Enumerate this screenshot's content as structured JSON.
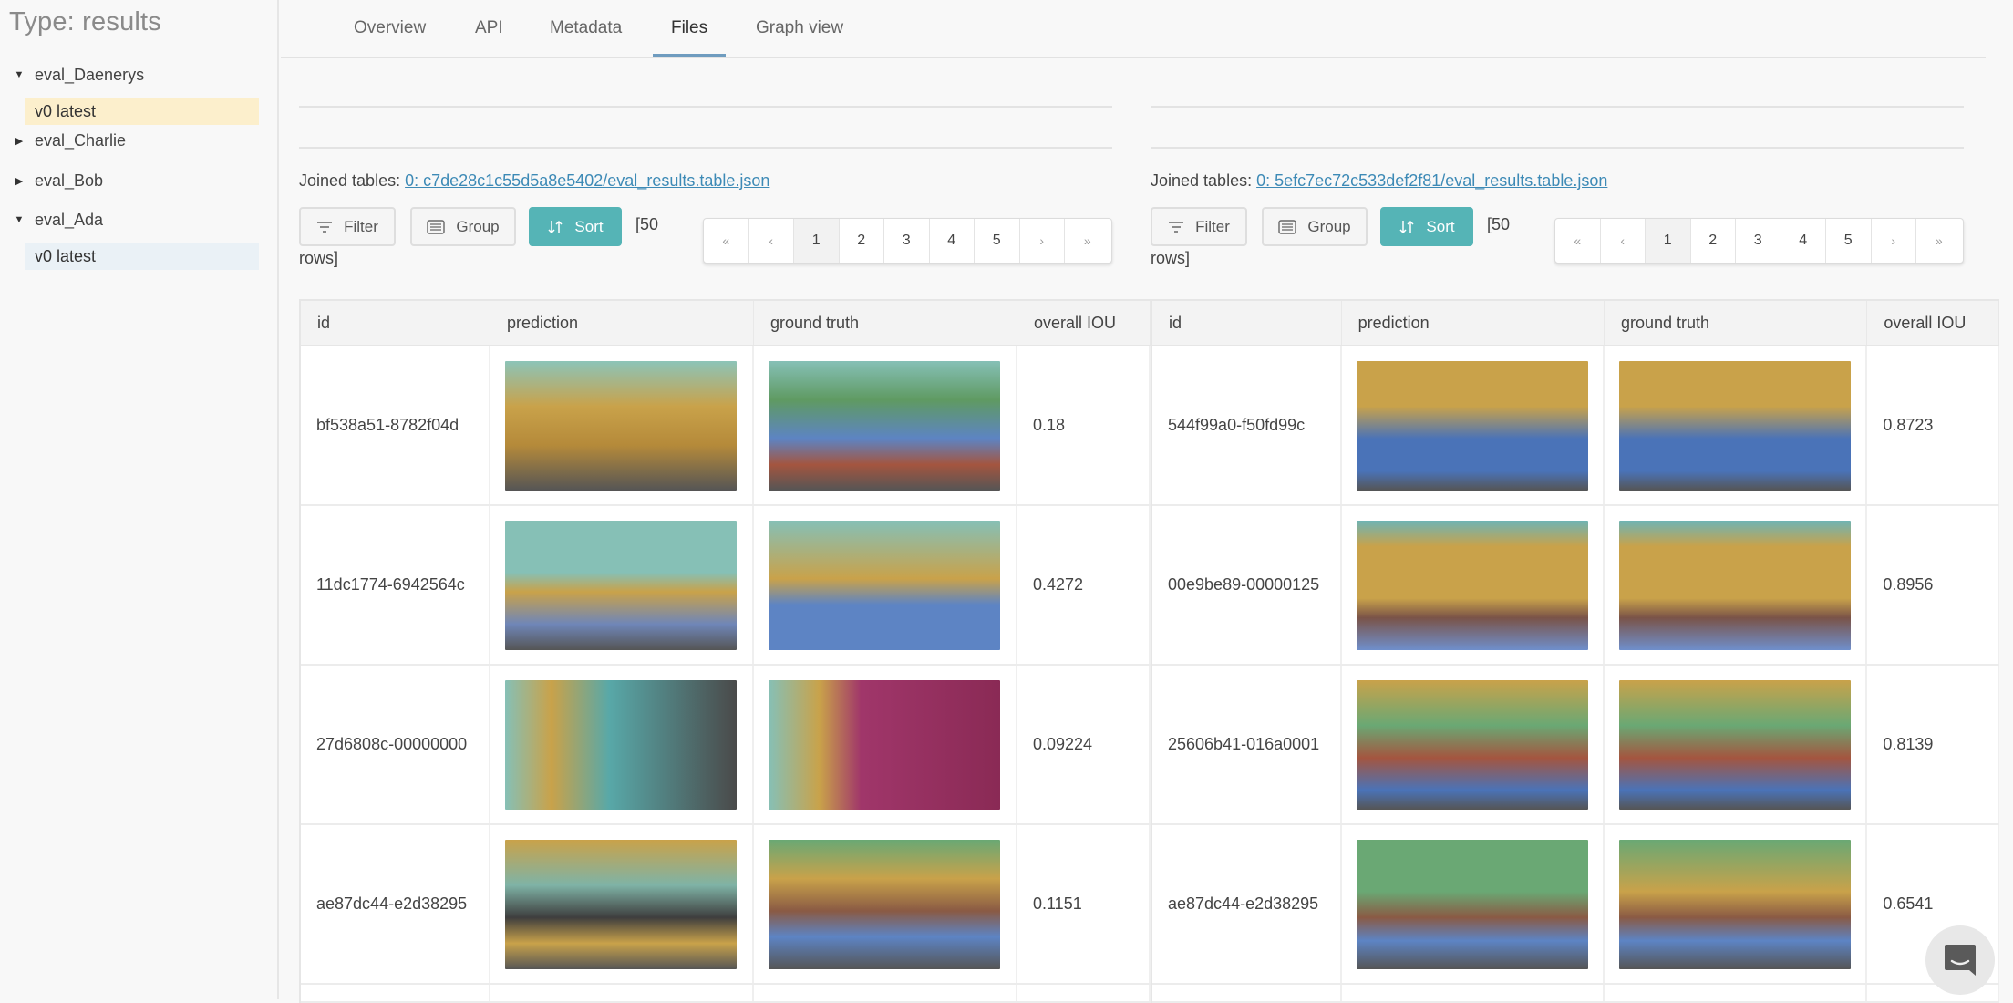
{
  "sidebar": {
    "title": "Type: results",
    "items": [
      {
        "label": "eval_Daenerys",
        "expanded": true,
        "versions": [
          {
            "label": "v0 latest",
            "highlight": "yellow"
          }
        ]
      },
      {
        "label": "eval_Charlie",
        "expanded": false,
        "versions": []
      },
      {
        "label": "eval_Bob",
        "expanded": false,
        "versions": []
      },
      {
        "label": "eval_Ada",
        "expanded": true,
        "versions": [
          {
            "label": "v0 latest",
            "highlight": "blue"
          }
        ]
      }
    ]
  },
  "tabs": [
    {
      "label": "Overview",
      "active": false
    },
    {
      "label": "API",
      "active": false
    },
    {
      "label": "Metadata",
      "active": false
    },
    {
      "label": "Files",
      "active": true
    },
    {
      "label": "Graph view",
      "active": false
    }
  ],
  "colors": {
    "accent_teal": "#55b4b6",
    "link_blue": "#3d8ab6",
    "tab_underline": "#6f9cbf",
    "highlight_yellow": "#fcefcc",
    "highlight_blue": "#eaf1f6"
  },
  "panels": [
    {
      "joined_label": "Joined tables:",
      "joined_link": "0: c7de28c1c55d5a8e5402/eval_results.table.json",
      "buttons": {
        "filter": "Filter",
        "group": "Group",
        "sort": "Sort"
      },
      "rows_note_1": "[50",
      "rows_note_2": "rows]",
      "pagination": [
        "«",
        "‹",
        "1",
        "2",
        "3",
        "4",
        "5",
        "›",
        "»"
      ],
      "current_page": "1",
      "columns": [
        "id",
        "prediction",
        "ground truth",
        "overall IOU"
      ],
      "rows": [
        {
          "id": "bf538a51-8782f04d",
          "prediction": "segmentation-image",
          "ground_truth": "segmentation-image",
          "iou": "0.18"
        },
        {
          "id": "11dc1774-6942564c",
          "prediction": "segmentation-image",
          "ground_truth": "segmentation-image",
          "iou": "0.4272"
        },
        {
          "id": "27d6808c-00000000",
          "prediction": "segmentation-image",
          "ground_truth": "segmentation-image",
          "iou": "0.09224"
        },
        {
          "id": "ae87dc44-e2d38295",
          "prediction": "segmentation-image",
          "ground_truth": "segmentation-image",
          "iou": "0.1151"
        }
      ]
    },
    {
      "joined_label": "Joined tables:",
      "joined_link": "0: 5efc7ec72c533def2f81/eval_results.table.json",
      "buttons": {
        "filter": "Filter",
        "group": "Group",
        "sort": "Sort"
      },
      "rows_note_1": "[50",
      "rows_note_2": "rows]",
      "pagination": [
        "«",
        "‹",
        "1",
        "2",
        "3",
        "4",
        "5",
        "›",
        "»"
      ],
      "current_page": "1",
      "columns": [
        "id",
        "prediction",
        "ground truth",
        "overall IOU"
      ],
      "rows": [
        {
          "id": "544f99a0-f50fd99c",
          "prediction": "segmentation-image",
          "ground_truth": "segmentation-image",
          "iou": "0.8723"
        },
        {
          "id": "00e9be89-00000125",
          "prediction": "segmentation-image",
          "ground_truth": "segmentation-image",
          "iou": "0.8956"
        },
        {
          "id": "25606b41-016a0001",
          "prediction": "segmentation-image",
          "ground_truth": "segmentation-image",
          "iou": "0.8139"
        },
        {
          "id": "ae87dc44-e2d38295",
          "prediction": "segmentation-image",
          "ground_truth": "segmentation-image",
          "iou": "0.6541"
        }
      ]
    }
  ],
  "icons": {
    "tree_expanded": "caret-down-icon",
    "tree_collapsed": "caret-right-icon",
    "filter": "filter-icon",
    "group": "group-list-icon",
    "sort": "sort-arrows-icon",
    "chat": "chat-support-icon"
  }
}
